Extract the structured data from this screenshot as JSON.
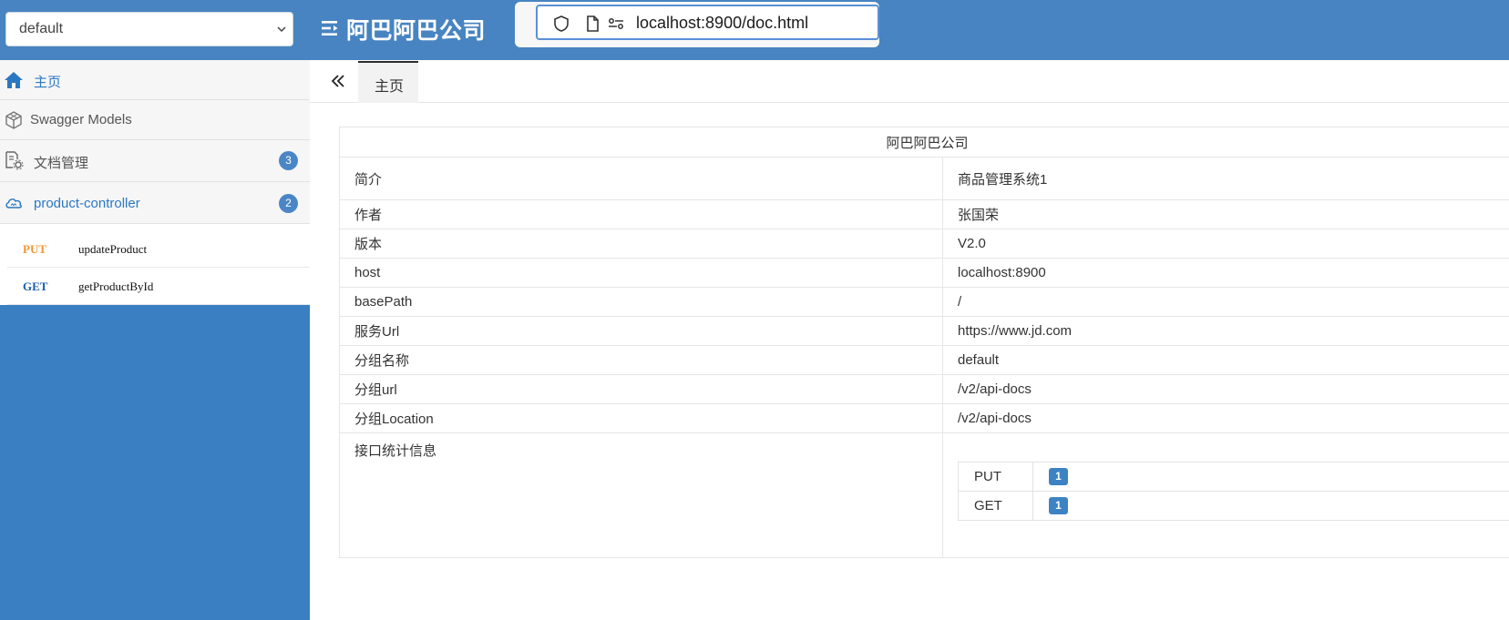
{
  "header": {
    "group_select_value": "default",
    "title": "阿巴阿巴公司"
  },
  "browser": {
    "url": "localhost:8900/doc.html"
  },
  "sidebar": {
    "items": [
      {
        "label": "主页",
        "icon": "home-icon"
      },
      {
        "label": "Swagger Models",
        "icon": "cube-icon"
      },
      {
        "label": "文档管理",
        "icon": "doc-settings-icon",
        "badge": "3"
      },
      {
        "label": "product-controller",
        "icon": "cloud-icon",
        "badge": "2"
      }
    ],
    "operations": [
      {
        "method": "PUT",
        "name": "updateProduct"
      },
      {
        "method": "GET",
        "name": "getProductById"
      }
    ]
  },
  "tabs": [
    {
      "label": "主页"
    }
  ],
  "info": {
    "title": "阿巴阿巴公司",
    "rows": [
      {
        "label": "简介",
        "value": "商品管理系统1"
      },
      {
        "label": "作者",
        "value": "张国荣"
      },
      {
        "label": "版本",
        "value": "V2.0"
      },
      {
        "label": "host",
        "value": "localhost:8900"
      },
      {
        "label": "basePath",
        "value": "/"
      },
      {
        "label": "服务Url",
        "value": "https://www.jd.com"
      },
      {
        "label": "分组名称",
        "value": "default"
      },
      {
        "label": "分组url",
        "value": "/v2/api-docs"
      },
      {
        "label": "分组Location",
        "value": "/v2/api-docs"
      }
    ],
    "stats_label": "接口统计信息",
    "stats": [
      {
        "method": "PUT",
        "count": "1"
      },
      {
        "method": "GET",
        "count": "1"
      }
    ]
  },
  "colors": {
    "topbar": "#4784c1",
    "sidebar_bg": "#3a7fc1",
    "active_nav": "#2b78c2",
    "put_method": "#f0962e",
    "get_method": "#1c5fa8",
    "badge": "#3d83c4"
  }
}
